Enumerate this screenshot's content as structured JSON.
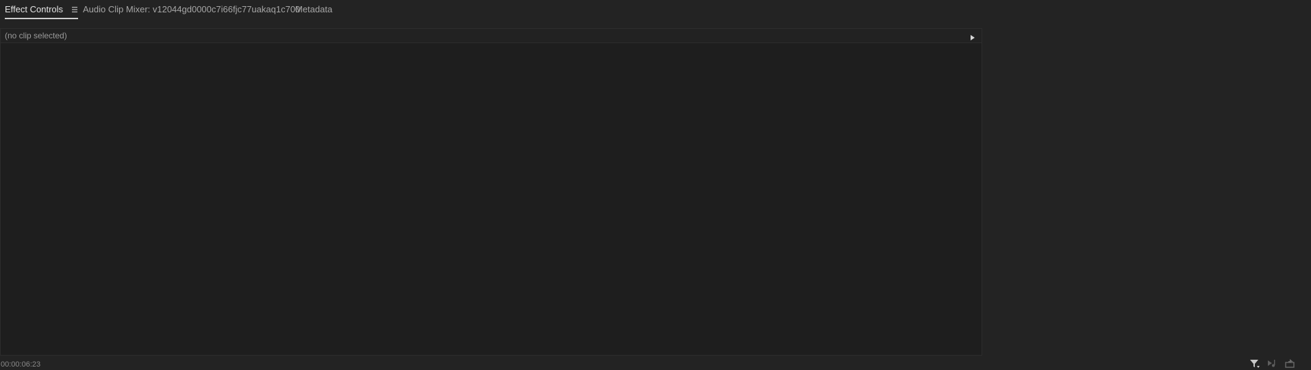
{
  "tabs": [
    {
      "label": "Effect Controls",
      "active": true
    },
    {
      "label": "Audio Clip Mixer: v12044gd0000c7i66fjc77uakaq1c700",
      "active": false
    },
    {
      "label": "Metadata",
      "active": false
    }
  ],
  "panel": {
    "header_label": "(no clip selected)"
  },
  "footer": {
    "timecode": "00:00:06:23"
  },
  "icons": {
    "tab_menu": "hamburger-menu-icon",
    "expand": "play-triangle-icon",
    "filter": "filter-icon",
    "play_audio": "play-audio-icon",
    "export": "export-icon"
  },
  "colors": {
    "background": "#232323",
    "panel": "#1e1e1e",
    "active_tab_text": "#e3e3e3"
  }
}
